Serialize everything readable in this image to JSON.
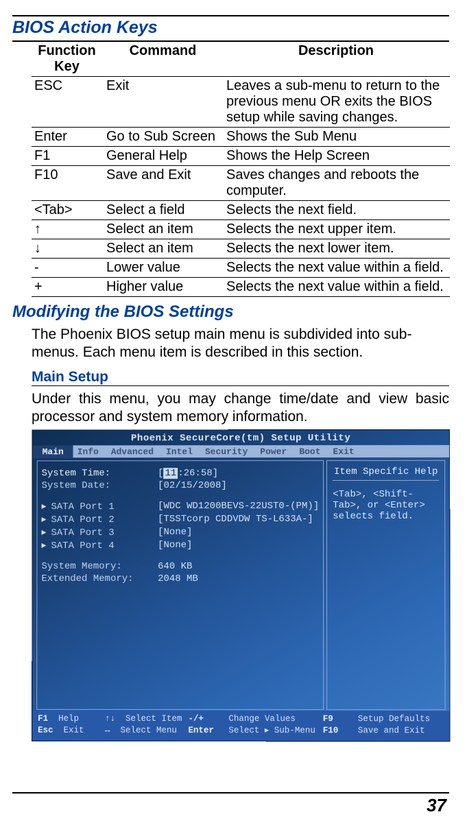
{
  "headings": {
    "h1": "BIOS Action Keys",
    "h2": "Modifying the BIOS Settings",
    "h3": "Main Setup"
  },
  "table": {
    "headers": {
      "c1": "Function Key",
      "c2": "Command",
      "c3": "Description"
    },
    "rows": [
      {
        "key": "ESC",
        "cmd": "Exit",
        "desc": "Leaves a sub-menu to return to the previous menu OR exits the BIOS setup while saving changes."
      },
      {
        "key": "Enter",
        "cmd": "Go to Sub Screen",
        "desc": "Shows the Sub Menu"
      },
      {
        "key": "F1",
        "cmd": "General Help",
        "desc": "Shows the Help Screen"
      },
      {
        "key": "F10",
        "cmd": "Save and Exit",
        "desc": "Saves changes and reboots the computer."
      },
      {
        "key": "<Tab>",
        "cmd": "Select a field",
        "desc": "Selects the next field."
      },
      {
        "key": "↑",
        "cmd": "Select an item",
        "desc": "Selects the next upper item."
      },
      {
        "key": "↓",
        "cmd": "Select an item",
        "desc": "Selects the next lower item."
      },
      {
        "key": "-",
        "cmd": "Lower value",
        "desc": "Selects the next value within a field."
      },
      {
        "key": "+",
        "cmd": "Higher value",
        "desc": "Selects the next value within a field."
      }
    ]
  },
  "paragraphs": {
    "p1": "The Phoenix BIOS setup main menu is subdivided into sub-menus. Each menu item is described in this section.",
    "p2": "Under this menu, you may change time/date and view basic processor and system memory information."
  },
  "bios": {
    "title": "Phoenix SecureCore(tm) Setup Utility",
    "menu": [
      "Main",
      "Info",
      "Advanced",
      "Intel",
      "Security",
      "Power",
      "Boot",
      "Exit"
    ],
    "active_menu": "Main",
    "fields": {
      "time_label": "System Time:",
      "time_value_sel": "11",
      "time_value_rest": ":26:58]",
      "date_label": "System Date:",
      "date_value": "[02/15/2008]",
      "sata1_label": "SATA Port 1",
      "sata1_value": "[WDC WD1200BEVS-22UST0-(PM)]",
      "sata2_label": "SATA Port 2",
      "sata2_value": "[TSSTcorp CDDVDW TS-L633A-]",
      "sata3_label": "SATA Port 3",
      "sata3_value": "[None]",
      "sata4_label": "SATA Port 4",
      "sata4_value": "[None]",
      "sysmem_label": "System Memory:",
      "sysmem_value": "640 KB",
      "extmem_label": "Extended Memory:",
      "extmem_value": "2048 MB"
    },
    "help": {
      "title": "Item Specific Help",
      "text": "<Tab>, <Shift-Tab>, or <Enter> selects field."
    },
    "footer": {
      "f1k": "F1",
      "f1t": "Help",
      "arrk": "↑↓",
      "arrt": "Select Item",
      "pmk": "-/+",
      "pmt": "Change Values",
      "f9k": "F9",
      "f9t": "Setup Defaults",
      "esck": "Esc",
      "esct": "Exit",
      "lrk": "↔",
      "lrt": "Select Menu",
      "entk": "Enter",
      "entt": "Select ▸ Sub-Menu",
      "f10k": "F10",
      "f10t": "Save and Exit"
    }
  },
  "page_number": "37"
}
